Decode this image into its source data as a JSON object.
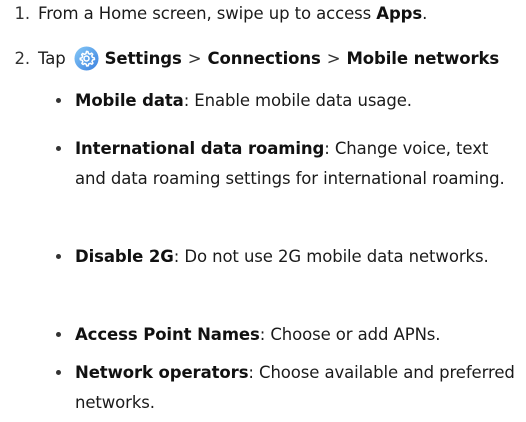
{
  "steps": [
    {
      "number": "1.",
      "text_before": "From a Home screen, swipe up to access ",
      "bold": "Apps",
      "text_after": "."
    },
    {
      "number": "2.",
      "prefix": "Tap",
      "icon": "settings-gear-icon",
      "path": [
        "Settings",
        "Connections",
        "Mobile networks"
      ],
      "separator": ">"
    }
  ],
  "options": [
    {
      "term": "Mobile data",
      "description": ": Enable mobile data usage."
    },
    {
      "term": "International data roaming",
      "description": ": Change voice, text and data roaming settings for international roaming."
    },
    {
      "term": "Disable 2G",
      "description": ": Do not use 2G mobile data networks."
    },
    {
      "term": "Access Point Names",
      "description": ": Choose or add APNs."
    },
    {
      "term": "Network operators",
      "description": ": Choose available and preferred networks."
    }
  ],
  "colors": {
    "icon_gradient_start": "#7ec3f7",
    "icon_gradient_end": "#3b82e0"
  }
}
